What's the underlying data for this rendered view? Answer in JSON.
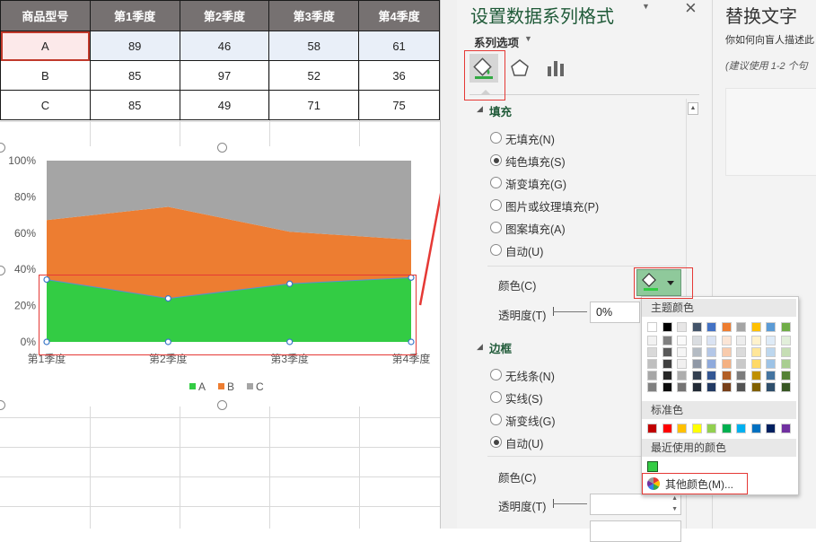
{
  "table": {
    "headers": [
      "商品型号",
      "第1季度",
      "第2季度",
      "第3季度",
      "第4季度"
    ],
    "rows": [
      [
        "A",
        "89",
        "46",
        "58",
        "61"
      ],
      [
        "B",
        "85",
        "97",
        "52",
        "36"
      ],
      [
        "C",
        "85",
        "49",
        "71",
        "75"
      ]
    ]
  },
  "chart_data": {
    "type": "area",
    "stacking": "percent",
    "categories": [
      "第1季度",
      "第2季度",
      "第3季度",
      "第4季度"
    ],
    "series": [
      {
        "name": "A",
        "values": [
          89,
          46,
          58,
          61
        ],
        "color": "#33cc44"
      },
      {
        "name": "B",
        "values": [
          85,
          97,
          52,
          36
        ],
        "color": "#ed7d31"
      },
      {
        "name": "C",
        "values": [
          85,
          49,
          71,
          75
        ],
        "color": "#a5a5a5"
      }
    ],
    "yticks": [
      "0%",
      "20%",
      "40%",
      "60%",
      "80%",
      "100%"
    ],
    "ylim": [
      0,
      100
    ],
    "legend": "bottom",
    "grid": false
  },
  "pane": {
    "title": "设置数据系列格式",
    "close_icon": "×",
    "dropdown_icon": "▼",
    "series_options_label": "系列选项",
    "fill_section": "填充",
    "fill_options": [
      "无填充(N)",
      "纯色填充(S)",
      "渐变填充(G)",
      "图片或纹理填充(P)",
      "图案填充(A)",
      "自动(U)"
    ],
    "fill_selected_index": 1,
    "color_label": "颜色(C)",
    "transparency_label": "透明度(T)",
    "transparency_value": "0%",
    "border_section": "边框",
    "border_options": [
      "无线条(N)",
      "实线(S)",
      "渐变线(G)",
      "自动(U)"
    ],
    "border_selected_index": 3,
    "border_color_label": "颜色(C)",
    "border_transparency_label": "透明度(T)"
  },
  "alt_text": {
    "title": "替换文字",
    "line1": "你如何向盲人描述此",
    "line2": "(建议使用 1-2 个句"
  },
  "color_popup": {
    "theme_colors_label": "主题颜色",
    "standard_colors_label": "标准色",
    "recent_colors_label": "最近使用的颜色",
    "more_colors_label": "其他颜色(M)...",
    "recent_color": "#33cc44",
    "theme_base": [
      "#ffffff",
      "#000000",
      "#e7e6e6",
      "#44546a",
      "#4472c4",
      "#ed7d31",
      "#a5a5a5",
      "#ffc000",
      "#5b9bd5",
      "#70ad47"
    ],
    "standard": [
      "#c00000",
      "#ff0000",
      "#ffc000",
      "#ffff00",
      "#92d050",
      "#00b050",
      "#00b0f0",
      "#0070c0",
      "#002060",
      "#7030a0"
    ]
  }
}
